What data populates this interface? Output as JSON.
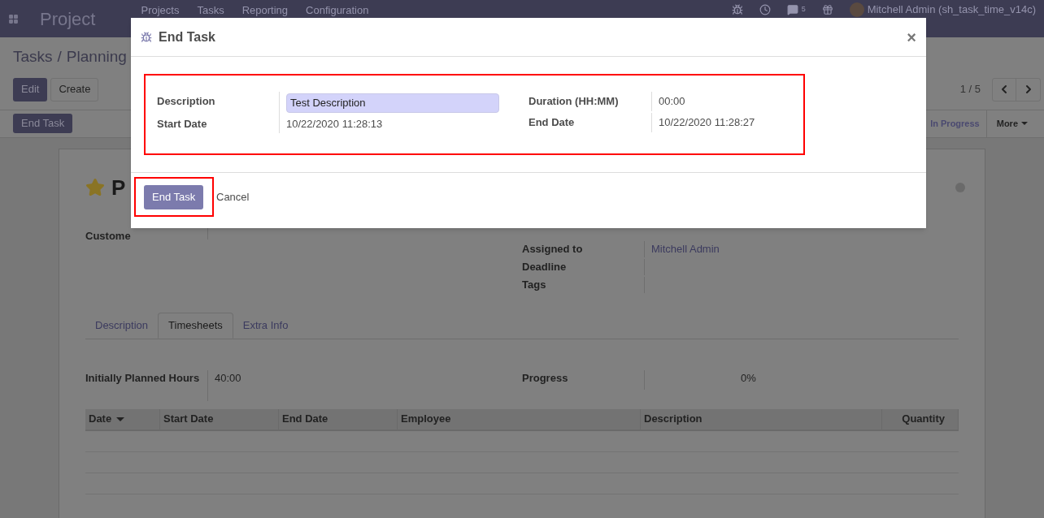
{
  "navbar": {
    "app_name": "Project",
    "menu": [
      "Projects",
      "Tasks",
      "Reporting",
      "Configuration"
    ],
    "chat_count": "5",
    "user": "Mitchell Admin (sh_task_time_v14c)"
  },
  "breadcrumb": {
    "items": [
      "Tasks",
      "Planning"
    ],
    "separator": "/"
  },
  "buttons": [
    "Edit",
    "Create"
  ],
  "pager": "1 / 5",
  "status_button": "End Task",
  "stages": [
    {
      "label": "In Progress",
      "selected": true
    }
  ],
  "more": "More",
  "task": {
    "title": "P",
    "starred": true,
    "left_fields": [
      {
        "label": "Custome"
      }
    ],
    "right_fields": [
      {
        "label": "Assigned to",
        "value": "Mitchell Admin"
      },
      {
        "label": "Deadline"
      },
      {
        "label": "Tags"
      }
    ],
    "tabs": [
      {
        "label": "Description",
        "selected": false
      },
      {
        "label": "Timesheets",
        "selected": true
      },
      {
        "label": "Extra Info",
        "selected": false
      }
    ],
    "planned": {
      "label": "Initially Planned Hours",
      "value": "40:00"
    },
    "progress": {
      "label": "Progress",
      "value": "0%"
    },
    "table": {
      "columns": [
        {
          "label": "Date",
          "sorted": true
        },
        {
          "label": "Start Date",
          "sorted": false
        },
        {
          "label": "End Date",
          "sorted": false
        },
        {
          "label": "Employee",
          "sorted": false
        },
        {
          "label": "Description",
          "sorted": false
        },
        {
          "label": "Quantity",
          "sorted": false
        }
      ]
    }
  },
  "dialog": {
    "title": "End Task",
    "close": "×",
    "left_fields": [
      {
        "label": "Description",
        "value": "Test Description",
        "kind": "input"
      },
      {
        "label": "Start Date",
        "value": "10/22/2020 11:28:13",
        "kind": "text"
      }
    ],
    "right_fields": [
      {
        "label": "Duration (HH:MM)",
        "value": "00:00",
        "kind": "text"
      },
      {
        "label": "End Date",
        "value": "10/22/2020 11:28:27",
        "kind": "text"
      }
    ],
    "primary_button": "End Task",
    "cancel": "Cancel"
  }
}
